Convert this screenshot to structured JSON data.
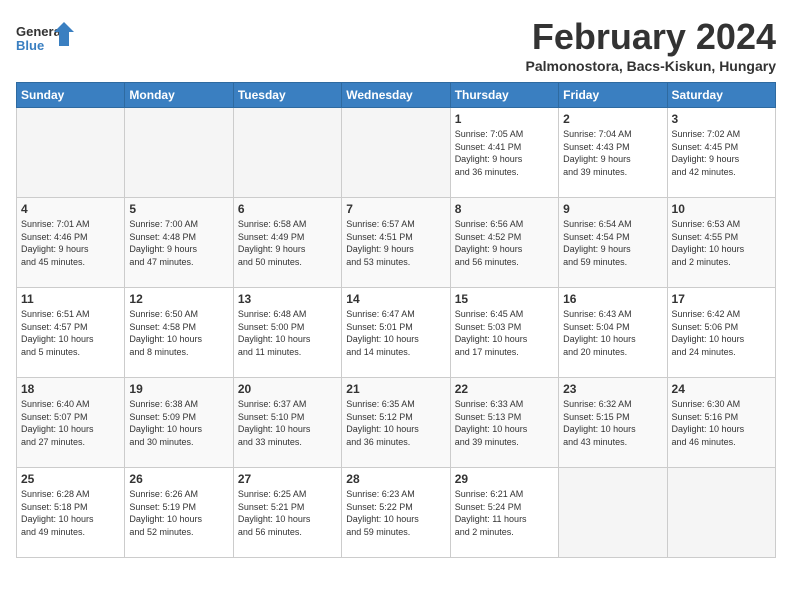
{
  "logo": {
    "line1": "General",
    "line2": "Blue"
  },
  "title": "February 2024",
  "subtitle": "Palmonostora, Bacs-Kiskun, Hungary",
  "days_of_week": [
    "Sunday",
    "Monday",
    "Tuesday",
    "Wednesday",
    "Thursday",
    "Friday",
    "Saturday"
  ],
  "weeks": [
    [
      {
        "day": "",
        "info": ""
      },
      {
        "day": "",
        "info": ""
      },
      {
        "day": "",
        "info": ""
      },
      {
        "day": "",
        "info": ""
      },
      {
        "day": "1",
        "info": "Sunrise: 7:05 AM\nSunset: 4:41 PM\nDaylight: 9 hours\nand 36 minutes."
      },
      {
        "day": "2",
        "info": "Sunrise: 7:04 AM\nSunset: 4:43 PM\nDaylight: 9 hours\nand 39 minutes."
      },
      {
        "day": "3",
        "info": "Sunrise: 7:02 AM\nSunset: 4:45 PM\nDaylight: 9 hours\nand 42 minutes."
      }
    ],
    [
      {
        "day": "4",
        "info": "Sunrise: 7:01 AM\nSunset: 4:46 PM\nDaylight: 9 hours\nand 45 minutes."
      },
      {
        "day": "5",
        "info": "Sunrise: 7:00 AM\nSunset: 4:48 PM\nDaylight: 9 hours\nand 47 minutes."
      },
      {
        "day": "6",
        "info": "Sunrise: 6:58 AM\nSunset: 4:49 PM\nDaylight: 9 hours\nand 50 minutes."
      },
      {
        "day": "7",
        "info": "Sunrise: 6:57 AM\nSunset: 4:51 PM\nDaylight: 9 hours\nand 53 minutes."
      },
      {
        "day": "8",
        "info": "Sunrise: 6:56 AM\nSunset: 4:52 PM\nDaylight: 9 hours\nand 56 minutes."
      },
      {
        "day": "9",
        "info": "Sunrise: 6:54 AM\nSunset: 4:54 PM\nDaylight: 9 hours\nand 59 minutes."
      },
      {
        "day": "10",
        "info": "Sunrise: 6:53 AM\nSunset: 4:55 PM\nDaylight: 10 hours\nand 2 minutes."
      }
    ],
    [
      {
        "day": "11",
        "info": "Sunrise: 6:51 AM\nSunset: 4:57 PM\nDaylight: 10 hours\nand 5 minutes."
      },
      {
        "day": "12",
        "info": "Sunrise: 6:50 AM\nSunset: 4:58 PM\nDaylight: 10 hours\nand 8 minutes."
      },
      {
        "day": "13",
        "info": "Sunrise: 6:48 AM\nSunset: 5:00 PM\nDaylight: 10 hours\nand 11 minutes."
      },
      {
        "day": "14",
        "info": "Sunrise: 6:47 AM\nSunset: 5:01 PM\nDaylight: 10 hours\nand 14 minutes."
      },
      {
        "day": "15",
        "info": "Sunrise: 6:45 AM\nSunset: 5:03 PM\nDaylight: 10 hours\nand 17 minutes."
      },
      {
        "day": "16",
        "info": "Sunrise: 6:43 AM\nSunset: 5:04 PM\nDaylight: 10 hours\nand 20 minutes."
      },
      {
        "day": "17",
        "info": "Sunrise: 6:42 AM\nSunset: 5:06 PM\nDaylight: 10 hours\nand 24 minutes."
      }
    ],
    [
      {
        "day": "18",
        "info": "Sunrise: 6:40 AM\nSunset: 5:07 PM\nDaylight: 10 hours\nand 27 minutes."
      },
      {
        "day": "19",
        "info": "Sunrise: 6:38 AM\nSunset: 5:09 PM\nDaylight: 10 hours\nand 30 minutes."
      },
      {
        "day": "20",
        "info": "Sunrise: 6:37 AM\nSunset: 5:10 PM\nDaylight: 10 hours\nand 33 minutes."
      },
      {
        "day": "21",
        "info": "Sunrise: 6:35 AM\nSunset: 5:12 PM\nDaylight: 10 hours\nand 36 minutes."
      },
      {
        "day": "22",
        "info": "Sunrise: 6:33 AM\nSunset: 5:13 PM\nDaylight: 10 hours\nand 39 minutes."
      },
      {
        "day": "23",
        "info": "Sunrise: 6:32 AM\nSunset: 5:15 PM\nDaylight: 10 hours\nand 43 minutes."
      },
      {
        "day": "24",
        "info": "Sunrise: 6:30 AM\nSunset: 5:16 PM\nDaylight: 10 hours\nand 46 minutes."
      }
    ],
    [
      {
        "day": "25",
        "info": "Sunrise: 6:28 AM\nSunset: 5:18 PM\nDaylight: 10 hours\nand 49 minutes."
      },
      {
        "day": "26",
        "info": "Sunrise: 6:26 AM\nSunset: 5:19 PM\nDaylight: 10 hours\nand 52 minutes."
      },
      {
        "day": "27",
        "info": "Sunrise: 6:25 AM\nSunset: 5:21 PM\nDaylight: 10 hours\nand 56 minutes."
      },
      {
        "day": "28",
        "info": "Sunrise: 6:23 AM\nSunset: 5:22 PM\nDaylight: 10 hours\nand 59 minutes."
      },
      {
        "day": "29",
        "info": "Sunrise: 6:21 AM\nSunset: 5:24 PM\nDaylight: 11 hours\nand 2 minutes."
      },
      {
        "day": "",
        "info": ""
      },
      {
        "day": "",
        "info": ""
      }
    ]
  ]
}
